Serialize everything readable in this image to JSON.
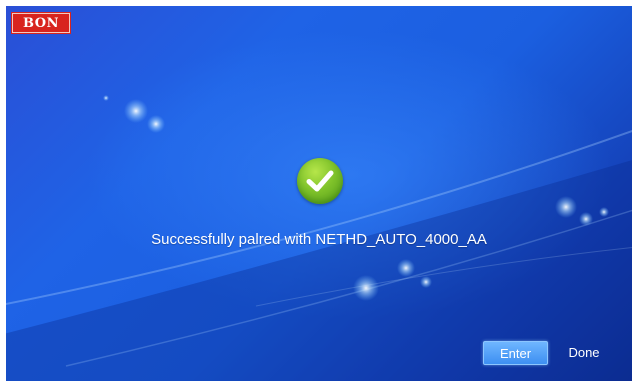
{
  "brand": {
    "logo_text": "BON",
    "logo_color": "#d8241e"
  },
  "dialog": {
    "status_icon": "check-circle-icon",
    "message": "Successfully palred with NETHD_AUTO_4000_AA"
  },
  "buttons": {
    "enter_label": "Enter",
    "done_label": "Done"
  },
  "colors": {
    "background": "#1f63e6",
    "success_green": "#7fc22a",
    "enter_button": "#3d8ff2"
  }
}
